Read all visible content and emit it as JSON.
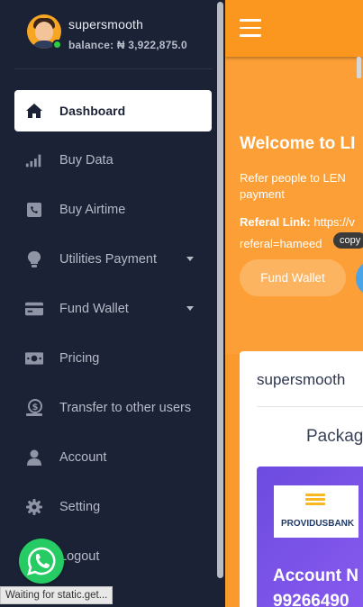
{
  "user": {
    "name": "supersmooth",
    "balance": "balance: ₦ 3,922,875.0"
  },
  "nav": {
    "items": [
      {
        "label": "Dashboard",
        "icon": "home-icon",
        "active": true
      },
      {
        "label": "Buy Data",
        "icon": "signal-bars-icon"
      },
      {
        "label": "Buy Airtime",
        "icon": "phone-icon"
      },
      {
        "label": "Utilities Payment",
        "icon": "lightbulb-icon",
        "dropdown": true
      },
      {
        "label": "Fund Wallet",
        "icon": "credit-card-icon",
        "dropdown": true
      },
      {
        "label": "Pricing",
        "icon": "money-icon"
      },
      {
        "label": "Transfer to other users",
        "icon": "dollar-hand-icon"
      },
      {
        "label": "Account",
        "icon": "user-icon"
      },
      {
        "label": "Setting",
        "icon": "gear-icon"
      },
      {
        "label": "Logout",
        "icon": "logout-icon"
      }
    ]
  },
  "main": {
    "welcome": "Welcome to LI",
    "refer_line1": "Refer people to LEN",
    "refer_line2": "payment",
    "referral_label": "Referal Link:",
    "referral_url_start": "https://v",
    "referral_url_end": "referal=hameed",
    "copy_tooltip": "copy",
    "fund_wallet_button": "Fund Wallet",
    "card_user": "supersmooth",
    "card_packages": "Packag",
    "bank_name": "PROVIDUSBANK",
    "account_label": "Account N",
    "account_number": "99266490"
  },
  "status_bar": "Waiting for static.get...",
  "colors": {
    "sidebar_bg": "#1b2236",
    "accent_orange": "#fb961e",
    "whatsapp_green": "#26cc63",
    "bank_purple": "#6d4be0"
  }
}
